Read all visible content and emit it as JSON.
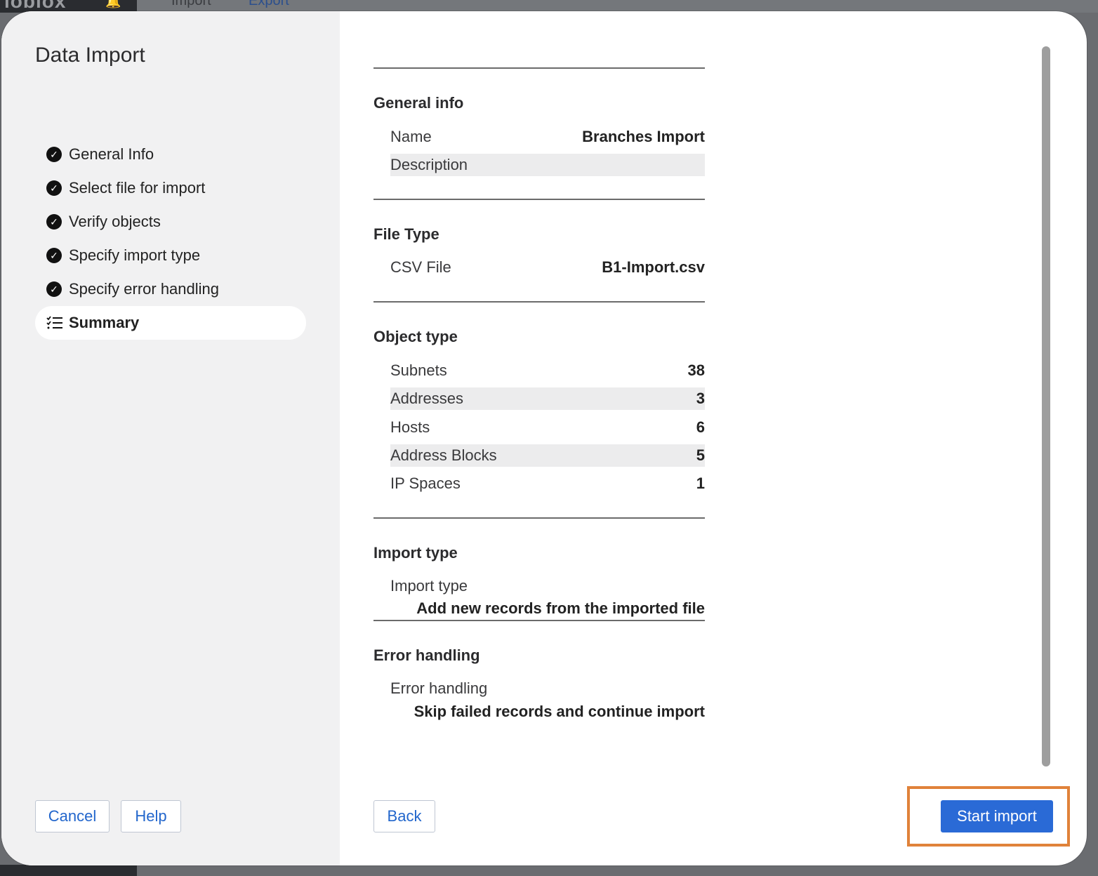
{
  "background": {
    "logo": "ioblox",
    "tabs": [
      "Import",
      "Export"
    ]
  },
  "modal": {
    "title": "Data Import",
    "steps": [
      {
        "label": "General Info",
        "status": "done"
      },
      {
        "label": "Select file for import",
        "status": "done"
      },
      {
        "label": "Verify objects",
        "status": "done"
      },
      {
        "label": "Specify import type",
        "status": "done"
      },
      {
        "label": "Specify error handling",
        "status": "done"
      },
      {
        "label": "Summary",
        "status": "active"
      }
    ],
    "buttons": {
      "cancel": "Cancel",
      "help": "Help",
      "back": "Back",
      "start": "Start import"
    }
  },
  "summary": {
    "general_info": {
      "title": "General info",
      "name_label": "Name",
      "name_value": "Branches Import",
      "description_label": "Description",
      "description_value": ""
    },
    "file_type": {
      "title": "File Type",
      "label": "CSV File",
      "value": "B1-Import.csv"
    },
    "object_type": {
      "title": "Object type",
      "rows": [
        {
          "label": "Subnets",
          "value": "38"
        },
        {
          "label": "Addresses",
          "value": "3"
        },
        {
          "label": "Hosts",
          "value": "6"
        },
        {
          "label": "Address Blocks",
          "value": "5"
        },
        {
          "label": "IP Spaces",
          "value": "1"
        }
      ]
    },
    "import_type": {
      "title": "Import type",
      "label": "Import type",
      "value": "Add new records from the imported file"
    },
    "error_handling": {
      "title": "Error handling",
      "label": "Error handling",
      "value": "Skip failed records and continue import"
    }
  },
  "colors": {
    "primary_button": "#2a6ad6",
    "link": "#2266cc",
    "highlight_border": "#e0823a",
    "sidebar_bg": "#f1f1f2"
  }
}
